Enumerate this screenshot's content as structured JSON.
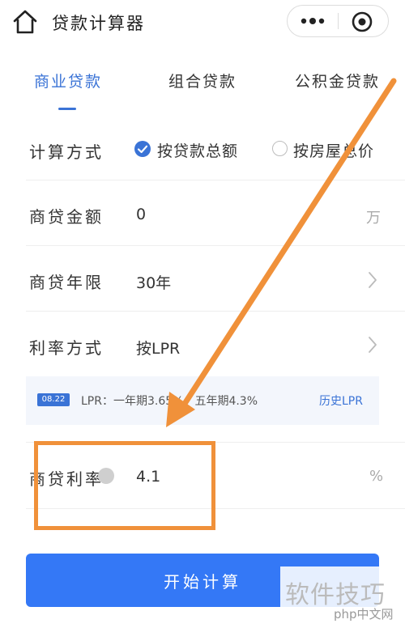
{
  "header": {
    "title": "贷款计算器",
    "home_icon": "home-icon",
    "menu_icons": [
      "more-icon",
      "target-icon"
    ]
  },
  "tabs": [
    {
      "label": "商业贷款",
      "active": true
    },
    {
      "label": "组合贷款",
      "active": false
    },
    {
      "label": "公积金贷款",
      "active": false
    }
  ],
  "form": {
    "calc_method": {
      "label": "计算方式",
      "options": [
        {
          "label": "按贷款总额",
          "selected": true
        },
        {
          "label": "按房屋总价",
          "selected": false
        }
      ]
    },
    "amount": {
      "label": "商贷金额",
      "value": "0",
      "unit": "万"
    },
    "term": {
      "label": "商贷年限",
      "value": "30年"
    },
    "rate_method": {
      "label": "利率方式",
      "value": "按LPR"
    },
    "lpr_info": {
      "badge": "08.22",
      "text": "LPR：一年期3.65%，五年期4.3%",
      "link": "历史LPR"
    },
    "rate": {
      "label": "商贷利率",
      "value": "4.1",
      "unit": "%"
    }
  },
  "button": {
    "label": "开始计算"
  },
  "watermark": {
    "text": "软件技巧",
    "logo": "php中文网"
  },
  "colors": {
    "accent": "#3a73d6",
    "button": "#3478f6",
    "annotation": "#f0913a"
  }
}
